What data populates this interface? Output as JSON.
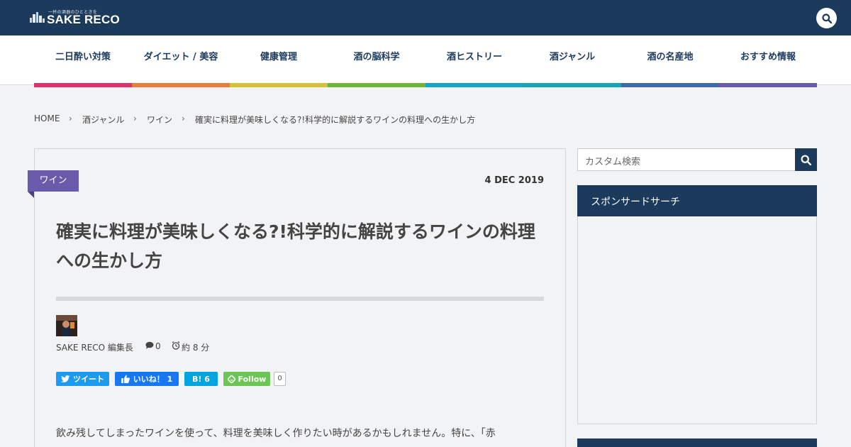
{
  "colors": {
    "header_bg": "#1c3a5c",
    "nav_text": "#1c3a5c",
    "category_tag": "#6a5aaa",
    "twitter": "#1d9bf0",
    "facebook": "#1877f2",
    "hatena": "#00a4de",
    "feedly": "#6cc655"
  },
  "header": {
    "logo_tagline": "一杯の酒器のひとときを",
    "logo_text": "SAKE RECO",
    "logo_icon": "city-skyline-icon",
    "search_icon": "search-icon"
  },
  "nav": {
    "items": [
      {
        "label": "二日酔い対策",
        "color": "#e1306c"
      },
      {
        "label": "ダイエット / 美容",
        "color": "#ea7b3a"
      },
      {
        "label": "健康管理",
        "color": "#d6c234"
      },
      {
        "label": "酒の脳科学",
        "color": "#6fb53a"
      },
      {
        "label": "酒ヒストリー",
        "color": "#13a6c6"
      },
      {
        "label": "酒ジャンル",
        "color": "#13a6b4"
      },
      {
        "label": "酒の名産地",
        "color": "#3f6aa8"
      },
      {
        "label": "おすすめ情報",
        "color": "#6a5aaa"
      }
    ]
  },
  "breadcrumb": {
    "items": [
      "HOME",
      "酒ジャンル",
      "ワイン",
      "確実に料理が美味しくなる?!科学的に解説するワインの料理への生かし方"
    ],
    "separator": "›"
  },
  "article": {
    "category": "ワイン",
    "date": "4 DEC 2019",
    "title": "確実に料理が美味しくなる?!科学的に解説するワインの料理への生かし方",
    "author": "SAKE RECO 編集長",
    "comments": "0",
    "read_time": "約 8 分",
    "body_first_line": "飲み残してしまったワインを使って、料理を美味しく作りたい時があるかもしれません。特に、「赤"
  },
  "share": {
    "tweet_label": "ツイート",
    "like_label": "いいね！ 1",
    "hatena_label": "B! 6",
    "follow_label": "Follow",
    "follow_count": "0"
  },
  "sidebar": {
    "search_placeholder": "カスタム検索",
    "sponsored_title": "スポンサードサーチ"
  }
}
